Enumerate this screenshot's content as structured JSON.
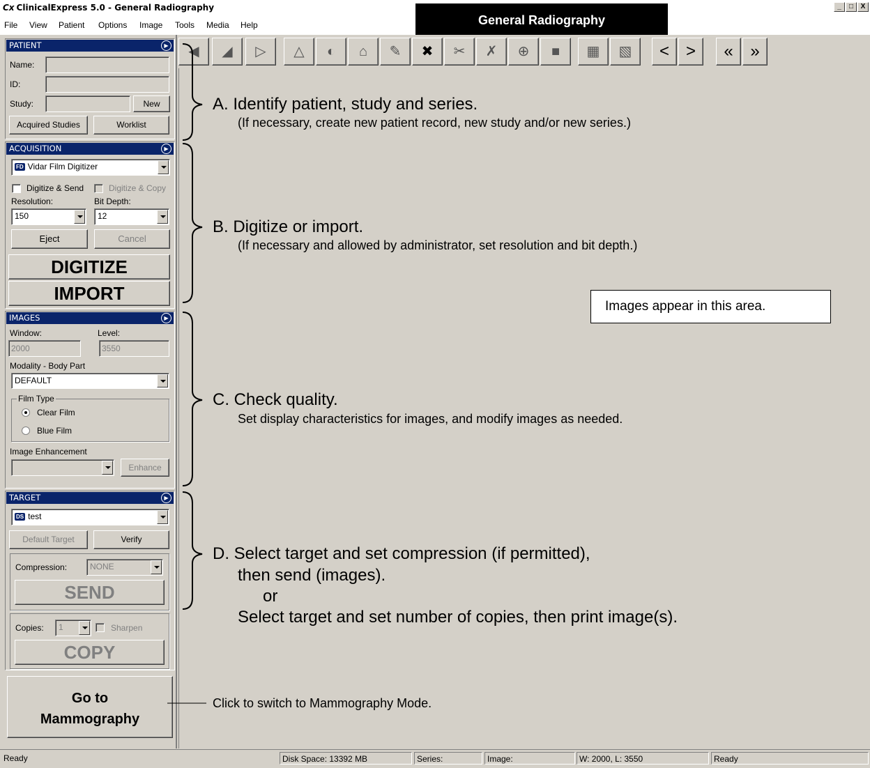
{
  "window": {
    "title": "ClinicalExpress 5.0 - General Radiography",
    "title_icon": "Cx",
    "buttons": [
      "_",
      "□",
      "X"
    ]
  },
  "menu": [
    "File",
    "View",
    "Patient",
    "Options",
    "Image",
    "Tools",
    "Media",
    "Help"
  ],
  "header_banner": "General Radiography",
  "toolbar": {
    "icons": [
      "rotate-left-icon",
      "rotate-right-icon",
      "flip-vertical-icon",
      "flip-horizontal-icon",
      "invert-icon",
      "home-icon",
      "annotate-icon",
      "delete-icon",
      "crop-icon",
      "cut-icon",
      "zoom-icon",
      "pan-icon",
      "grid-icon",
      "multi-image-icon"
    ],
    "nav": [
      "<",
      ">",
      "«",
      "»"
    ]
  },
  "patient": {
    "header": "PATIENT",
    "name_label": "Name:",
    "id_label": "ID:",
    "study_label": "Study:",
    "new_button": "New",
    "acquired_studies_button": "Acquired Studies",
    "worklist_button": "Worklist"
  },
  "acquisition": {
    "header": "ACQUISITION",
    "device_badge": "FD",
    "device": "Vidar Film Digitizer",
    "digitize_send": "Digitize & Send",
    "digitize_copy": "Digitize & Copy",
    "resolution_label": "Resolution:",
    "bitdepth_label": "Bit Depth:",
    "resolution": "150",
    "bitdepth": "12",
    "eject_button": "Eject",
    "cancel_button": "Cancel",
    "digitize_button": "DIGITIZE",
    "import_button": "IMPORT"
  },
  "images": {
    "header": "IMAGES",
    "window_label": "Window:",
    "level_label": "Level:",
    "window": "2000",
    "level": "3550",
    "modality_label": "Modality - Body Part",
    "modality": "DEFAULT",
    "film_type_label": "Film Type",
    "clear_film": "Clear Film",
    "blue_film": "Blue Film",
    "enhancement_label": "Image Enhancement",
    "enhance_button": "Enhance"
  },
  "target": {
    "header": "TARGET",
    "target_badge": "DS",
    "target": "test",
    "default_target_button": "Default Target",
    "verify_button": "Verify",
    "compression_label": "Compression:",
    "compression": "NONE",
    "send_button": "SEND",
    "copies_label": "Copies:",
    "copies": "1",
    "sharpen": "Sharpen",
    "copy_button": "COPY"
  },
  "mammography_button": {
    "line1": "Go to",
    "line2": "Mammography"
  },
  "annotations": {
    "a_title": "A.  Identify patient, study and series.",
    "a_sub": "(If necessary, create new patient record, new study and/or new series.)",
    "b_title": "B.  Digitize or import.",
    "b_sub": "(If necessary and allowed by administrator, set resolution and bit depth.)",
    "c_title": "C.  Check quality.",
    "c_sub": "Set display characteristics for images, and modify images as needed.",
    "d_title": "D.  Select target and set compression (if permitted),",
    "d_line2": "then send (images).",
    "d_or": "or",
    "d_line3": "Select target and set number of copies, then print image(s).",
    "images_area": "Images appear in this area.",
    "mammo_click": "Click to switch to Mammography Mode."
  },
  "status": {
    "ready_left": "Ready",
    "disk_space": "Disk Space: 13392 MB",
    "series": "Series:",
    "image": "Image:",
    "wl": "W: 2000, L: 3550",
    "ready_right": "Ready"
  }
}
